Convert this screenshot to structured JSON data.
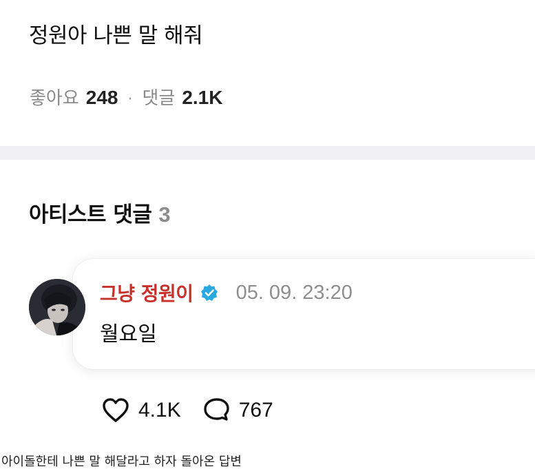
{
  "post": {
    "title": "정원아 나쁜 말 해줘",
    "likes_label": "좋아요",
    "likes_count": "248",
    "separator": "·",
    "comments_label": "댓글",
    "comments_count": "2.1K"
  },
  "artist_comments": {
    "heading": "아티스트 댓글",
    "count": "3",
    "items": [
      {
        "author": "그냥 정원이",
        "verified": true,
        "timestamp": "05. 09. 23:20",
        "text": "월요일",
        "likes": "4.1K",
        "replies": "767"
      }
    ]
  },
  "caption": "아이돌한테 나쁜 말 해달라고 하자 돌아온 답변",
  "colors": {
    "author": "#c8302a",
    "verified_badge": "#29a9e0",
    "muted_text": "#8a8a8a",
    "divider": "#f1f1f3"
  },
  "icons": {
    "verified": "verified-badge-icon",
    "like": "heart-icon",
    "reply": "speech-bubble-icon"
  }
}
